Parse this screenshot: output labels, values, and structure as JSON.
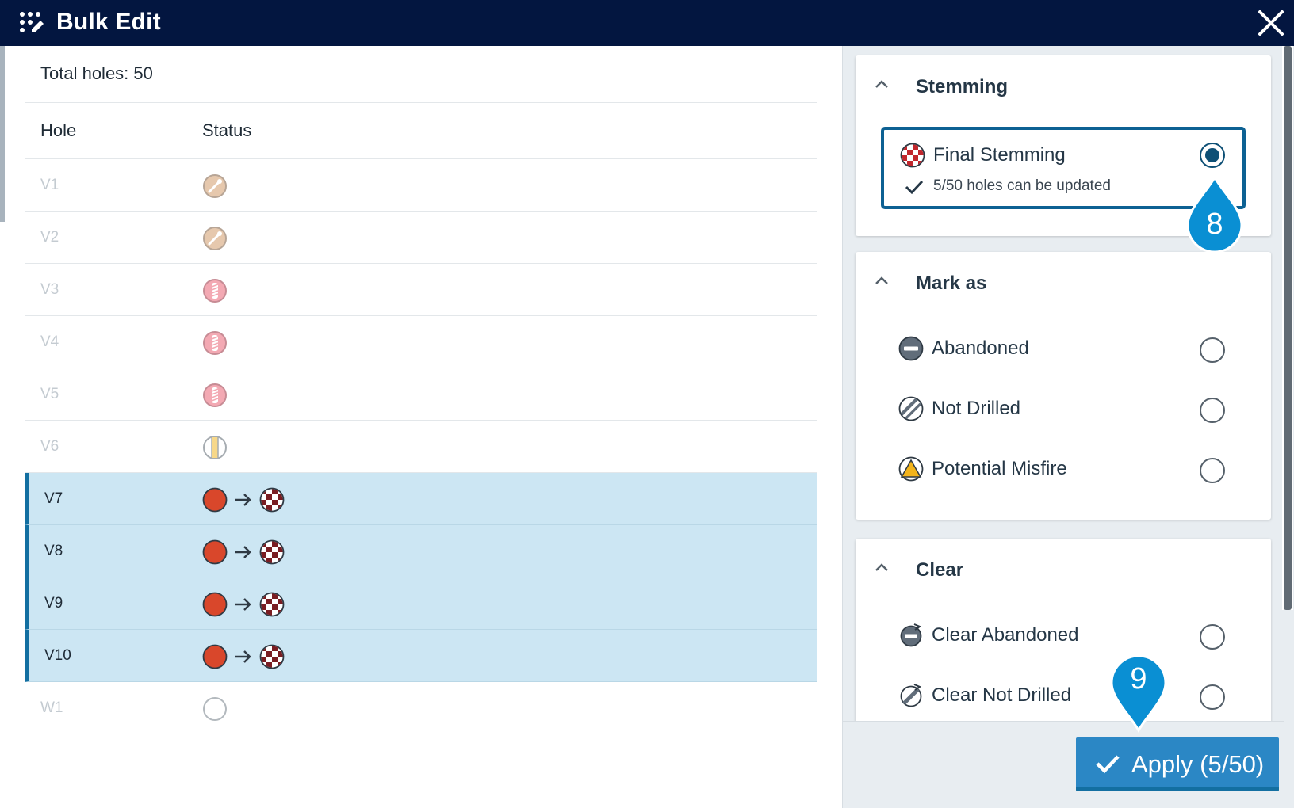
{
  "header": {
    "title": "Bulk Edit",
    "icons": {
      "app": "dots-pencil-icon",
      "close": "close-icon"
    }
  },
  "left": {
    "total_label": "Total holes: 50",
    "columns": {
      "hole": "Hole",
      "status": "Status"
    },
    "rows": [
      {
        "hole": "V1",
        "status_icon": "drilled-tan-icon",
        "selected": false
      },
      {
        "hole": "V2",
        "status_icon": "drilled-tan-icon",
        "selected": false
      },
      {
        "hole": "V3",
        "status_icon": "pink-striped-icon",
        "selected": false
      },
      {
        "hole": "V4",
        "status_icon": "pink-striped-icon",
        "selected": false
      },
      {
        "hole": "V5",
        "status_icon": "pink-striped-icon",
        "selected": false
      },
      {
        "hole": "V6",
        "status_icon": "yellow-split-icon",
        "selected": false
      },
      {
        "hole": "V7",
        "status_icon": "red-circle-to-stemming-icon",
        "selected": true
      },
      {
        "hole": "V8",
        "status_icon": "red-circle-to-stemming-icon",
        "selected": true
      },
      {
        "hole": "V9",
        "status_icon": "red-circle-to-stemming-icon",
        "selected": true
      },
      {
        "hole": "V10",
        "status_icon": "red-circle-to-stemming-icon",
        "selected": true
      },
      {
        "hole": "W1",
        "status_icon": "empty-circle-icon",
        "selected": false
      }
    ]
  },
  "right": {
    "stemming": {
      "title": "Stemming",
      "option": {
        "label": "Final Stemming",
        "subtext": "5/50 holes can be updated",
        "selected": true
      }
    },
    "mark_as": {
      "title": "Mark as",
      "options": [
        {
          "label": "Abandoned",
          "icon": "abandoned-icon"
        },
        {
          "label": "Not Drilled",
          "icon": "not-drilled-icon"
        },
        {
          "label": "Potential Misfire",
          "icon": "misfire-warning-icon"
        }
      ]
    },
    "clear": {
      "title": "Clear",
      "options": [
        {
          "label": "Clear Abandoned",
          "icon": "clear-abandoned-icon"
        },
        {
          "label": "Clear Not Drilled",
          "icon": "clear-not-drilled-icon"
        }
      ]
    }
  },
  "apply": {
    "label": "Apply (5/50)"
  },
  "markers": {
    "m8": "8",
    "m9": "9"
  },
  "colors": {
    "header_bg": "#031640",
    "selected_row_bg": "#cce6f3",
    "accent": "#0d6193",
    "apply_bg": "#2b87c5",
    "marker": "#0a8fd3",
    "red_status": "#d9472b",
    "stemming_dark": "#7a1d22"
  }
}
